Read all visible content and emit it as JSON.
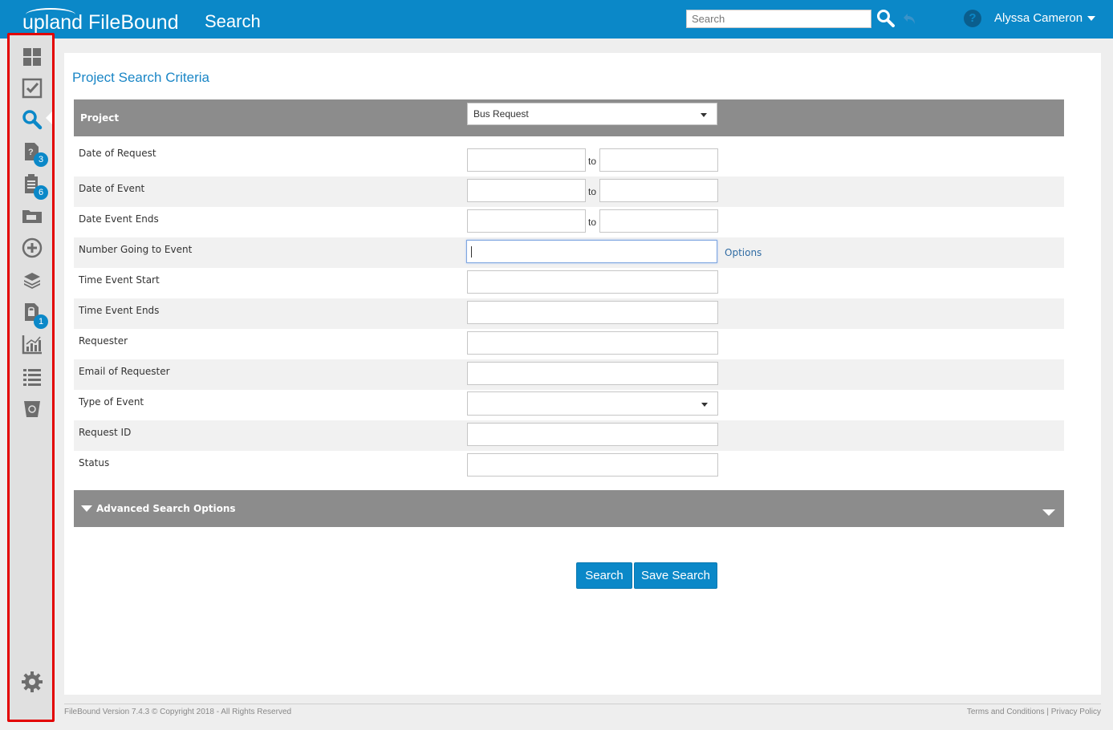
{
  "header": {
    "brand_light": "upland",
    "brand_bold": "FileBound",
    "page_title": "Search",
    "search_placeholder": "Search",
    "user_name": "Alyssa Cameron"
  },
  "sidebar": {
    "items": [
      {
        "icon": "dashboard-icon"
      },
      {
        "icon": "checkbox-icon"
      },
      {
        "icon": "search-icon",
        "active": true
      },
      {
        "icon": "help-document-icon",
        "badge": "3"
      },
      {
        "icon": "clipboard-icon",
        "badge": "6"
      },
      {
        "icon": "folder-icon"
      },
      {
        "icon": "add-circle-icon"
      },
      {
        "icon": "layers-icon"
      },
      {
        "icon": "lock-document-icon",
        "badge": "1"
      },
      {
        "icon": "report-chart-icon"
      },
      {
        "icon": "list-icon"
      },
      {
        "icon": "recycle-bin-icon"
      }
    ],
    "settings_icon": "gear-icon"
  },
  "main": {
    "title": "Project Search Criteria",
    "project_label": "Project",
    "project_selected": "Bus Request",
    "to_label": "to",
    "options_label": "Options",
    "fields": [
      {
        "label": "Date of Request",
        "type": "range"
      },
      {
        "label": "Date of Event",
        "type": "range"
      },
      {
        "label": "Date Event Ends",
        "type": "range"
      },
      {
        "label": "Number Going to Event",
        "type": "focused"
      },
      {
        "label": "Time Event Start",
        "type": "text"
      },
      {
        "label": "Time Event Ends",
        "type": "text"
      },
      {
        "label": "Requester",
        "type": "text"
      },
      {
        "label": "Email of Requester",
        "type": "text"
      },
      {
        "label": "Type of Event",
        "type": "select"
      },
      {
        "label": "Request ID",
        "type": "text"
      },
      {
        "label": "Status",
        "type": "text"
      }
    ],
    "advanced_label": "Advanced Search Options",
    "search_button": "Search",
    "save_search_button": "Save Search"
  },
  "footer": {
    "version": "FileBound Version 7.4.3 © Copyright 2018 - All Rights Reserved",
    "terms": "Terms and Conditions",
    "separator": "|",
    "privacy": "Privacy Policy"
  },
  "colors": {
    "brand_blue": "#0b88c8",
    "bar_gray": "#8c8c8c",
    "sidebar_highlight": "#e30000"
  }
}
